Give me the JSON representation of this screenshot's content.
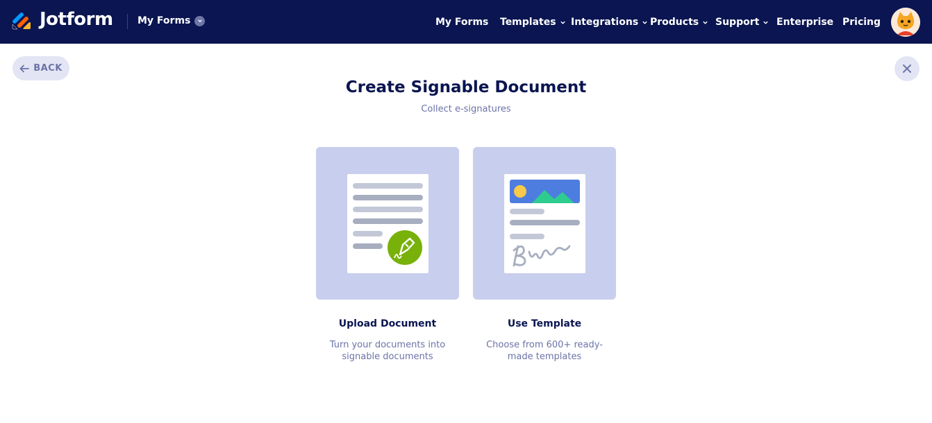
{
  "header": {
    "brand": "Jotform",
    "my_forms_dropdown": "My Forms",
    "nav": [
      {
        "label": "My Forms",
        "has_dropdown": false
      },
      {
        "label": "Templates",
        "has_dropdown": true
      },
      {
        "label": "Integrations",
        "has_dropdown": true
      },
      {
        "label": "Products",
        "has_dropdown": true
      },
      {
        "label": "Support",
        "has_dropdown": true
      },
      {
        "label": "Enterprise",
        "has_dropdown": false
      },
      {
        "label": "Pricing",
        "has_dropdown": false
      }
    ],
    "avatar_icon": "user-avatar-icon"
  },
  "back_button": {
    "label": "BACK",
    "icon": "arrow-left-icon"
  },
  "close_button": {
    "icon": "close-icon"
  },
  "page": {
    "title": "Create Signable Document",
    "subtitle": "Collect e-signatures"
  },
  "options": [
    {
      "title": "Upload Document",
      "description": "Turn your documents into signable documents",
      "icon": "document-signature-icon"
    },
    {
      "title": "Use Template",
      "description": "Choose from 600+ ready-made templates",
      "icon": "template-signature-icon"
    }
  ],
  "colors": {
    "header_bg": "#0a1551",
    "card_bg": "#c8ceed",
    "accent_green": "#78b10a",
    "muted_text": "#6c73a8"
  }
}
